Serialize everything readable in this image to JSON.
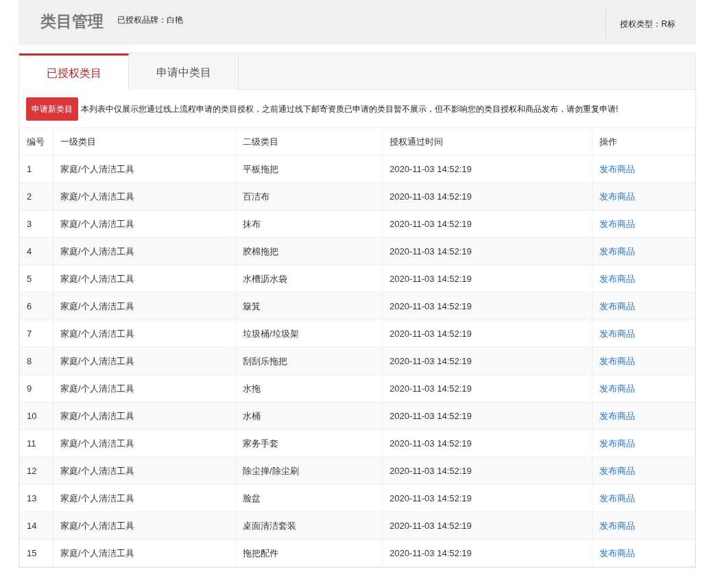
{
  "header": {
    "title": "类目管理",
    "brand": "已授权品牌：白艳",
    "auth_type": "授权类型：R标"
  },
  "tabs": [
    {
      "label": "已授权类目",
      "selected": true
    },
    {
      "label": "申请中类目",
      "selected": false
    }
  ],
  "apply_button": "申请新类目",
  "notice": "本列表中仅展示您通过线上流程申请的类目授权，之前通过线下邮寄资质已申请的类目暂不展示，但不影响您的类目授权和商品发布，请勿重复申请!",
  "table": {
    "columns": [
      "编号",
      "一级类目",
      "二级类目",
      "授权通过时间",
      "操作"
    ],
    "rows": [
      [
        "1",
        "家庭/个人清洁工具",
        "平板拖把",
        "2020-11-03 14:52:19",
        "发布商品"
      ],
      [
        "2",
        "家庭/个人清洁工具",
        "百洁布",
        "2020-11-03 14:52:19",
        "发布商品"
      ],
      [
        "3",
        "家庭/个人清洁工具",
        "抹布",
        "2020-11-03 14:52:19",
        "发布商品"
      ],
      [
        "4",
        "家庭/个人清洁工具",
        "胶棉拖把",
        "2020-11-03 14:52:19",
        "发布商品"
      ],
      [
        "5",
        "家庭/个人清洁工具",
        "水槽沥水袋",
        "2020-11-03 14:52:19",
        "发布商品"
      ],
      [
        "6",
        "家庭/个人清洁工具",
        "簸箕",
        "2020-11-03 14:52:19",
        "发布商品"
      ],
      [
        "7",
        "家庭/个人清洁工具",
        "垃圾桶/垃圾架",
        "2020-11-03 14:52:19",
        "发布商品"
      ],
      [
        "8",
        "家庭/个人清洁工具",
        "刮刮乐拖把",
        "2020-11-03 14:52:19",
        "发布商品"
      ],
      [
        "9",
        "家庭/个人清洁工具",
        "水拖",
        "2020-11-03 14:52:19",
        "发布商品"
      ],
      [
        "10",
        "家庭/个人清洁工具",
        "水桶",
        "2020-11-03 14:52:19",
        "发布商品"
      ],
      [
        "11",
        "家庭/个人清洁工具",
        "家务手套",
        "2020-11-03 14:52:19",
        "发布商品"
      ],
      [
        "12",
        "家庭/个人清洁工具",
        "除尘掸/除尘刷",
        "2020-11-03 14:52:19",
        "发布商品"
      ],
      [
        "13",
        "家庭/个人清洁工具",
        "脸盆",
        "2020-11-03 14:52:19",
        "发布商品"
      ],
      [
        "14",
        "家庭/个人清洁工具",
        "桌面清洁套装",
        "2020-11-03 14:52:19",
        "发布商品"
      ],
      [
        "15",
        "家庭/个人清洁工具",
        "拖把配件",
        "2020-11-03 14:52:19",
        "发布商品"
      ]
    ]
  }
}
